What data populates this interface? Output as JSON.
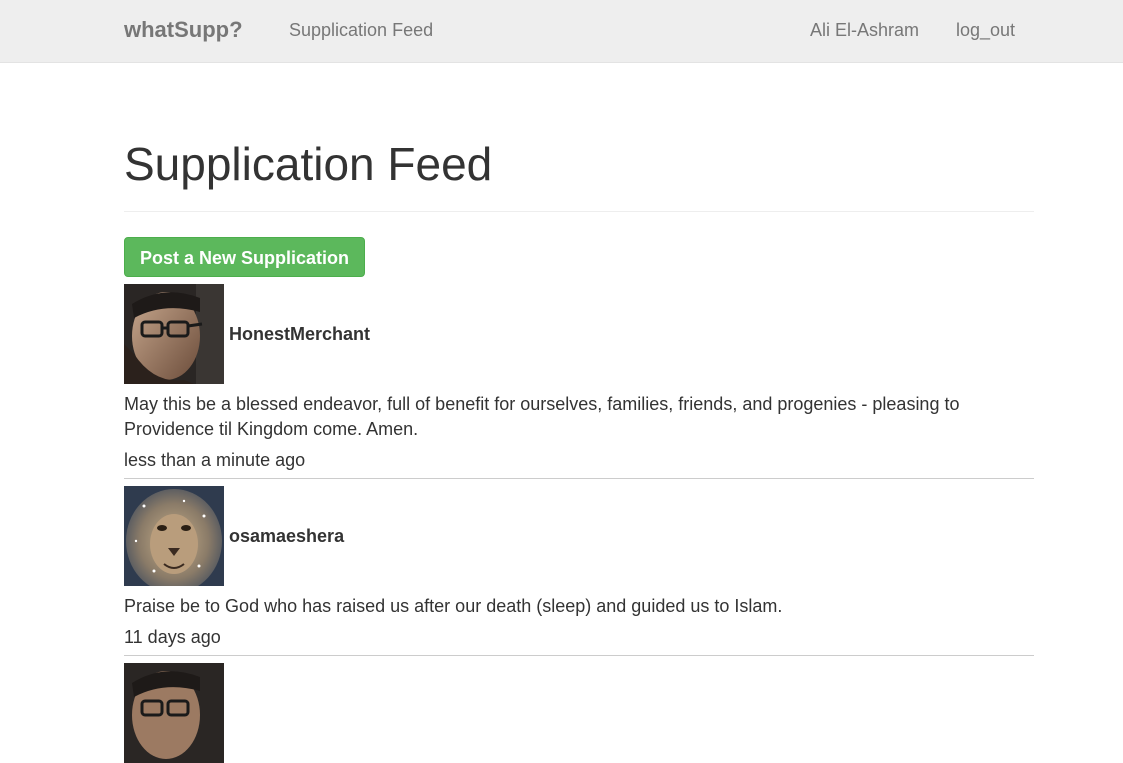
{
  "navbar": {
    "brand": "whatSupp?",
    "feed_link": "Supplication Feed",
    "user": "Ali El-Ashram",
    "logout": "log_out"
  },
  "page": {
    "title": "Supplication Feed",
    "post_button": "Post a New Supplication"
  },
  "posts": [
    {
      "username": "HonestMerchant",
      "avatar": "man-with-glasses-photo",
      "text": "May this be a blessed endeavor, full of benefit for ourselves, families, friends, and progenies - pleasing to Providence til Kingdom come. Amen.",
      "time": "less than a minute ago"
    },
    {
      "username": "osamaeshera",
      "avatar": "lion-face-photo",
      "text": "Praise be to God who has raised us after our death (sleep) and guided us to Islam.",
      "time": "11 days ago"
    },
    {
      "avatar": "man-with-glasses-photo"
    }
  ],
  "colors": {
    "navbar_bg": "#eeeeee",
    "nav_text": "#777777",
    "button_green": "#5cb85c"
  }
}
